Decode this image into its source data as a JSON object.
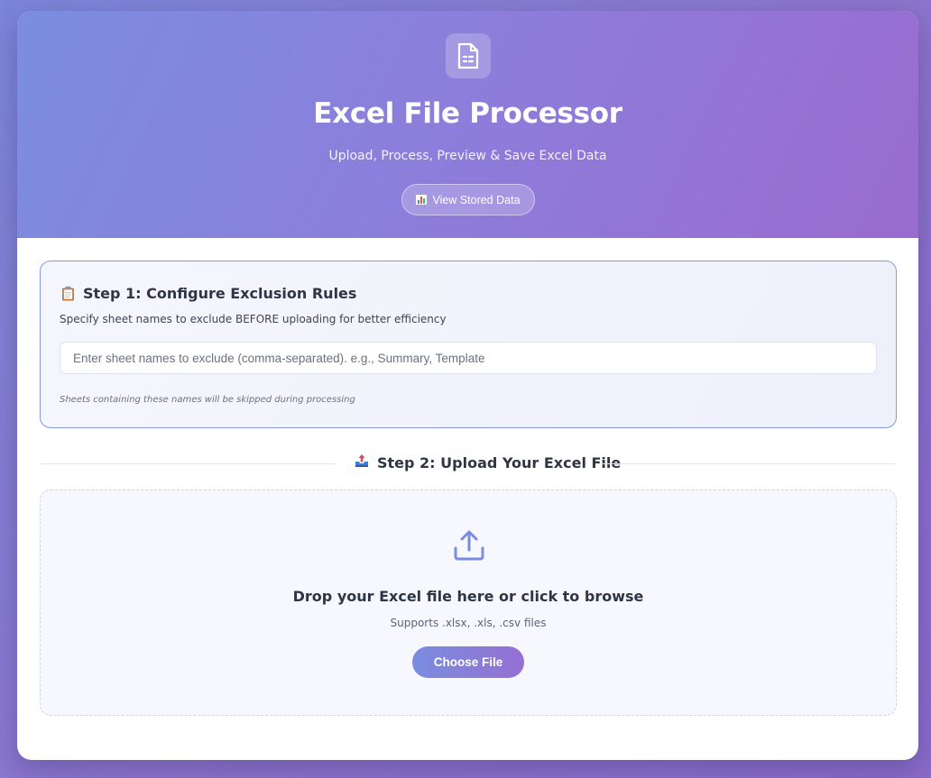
{
  "header": {
    "title": "Excel File Processor",
    "subtitle": "Upload, Process, Preview & Save Excel Data",
    "view_button_label": "View Stored Data"
  },
  "step1": {
    "title": "Step 1: Configure Exclusion Rules",
    "description": "Specify sheet names to exclude BEFORE uploading for better efficiency",
    "input_value": "",
    "input_placeholder": "Enter sheet names to exclude (comma-separated). e.g., Summary, Template",
    "note": "Sheets containing these names will be skipped during processing"
  },
  "step2": {
    "title": "Step 2: Upload Your Excel File",
    "drop_title": "Drop your Excel file here or click to browse",
    "drop_subtitle": "Supports .xlsx, .xls, .csv files",
    "choose_button_label": "Choose File"
  },
  "colors": {
    "accent_start": "#7b8ddf",
    "accent_end": "#9a6bcf",
    "text_dark": "#2f3544"
  }
}
